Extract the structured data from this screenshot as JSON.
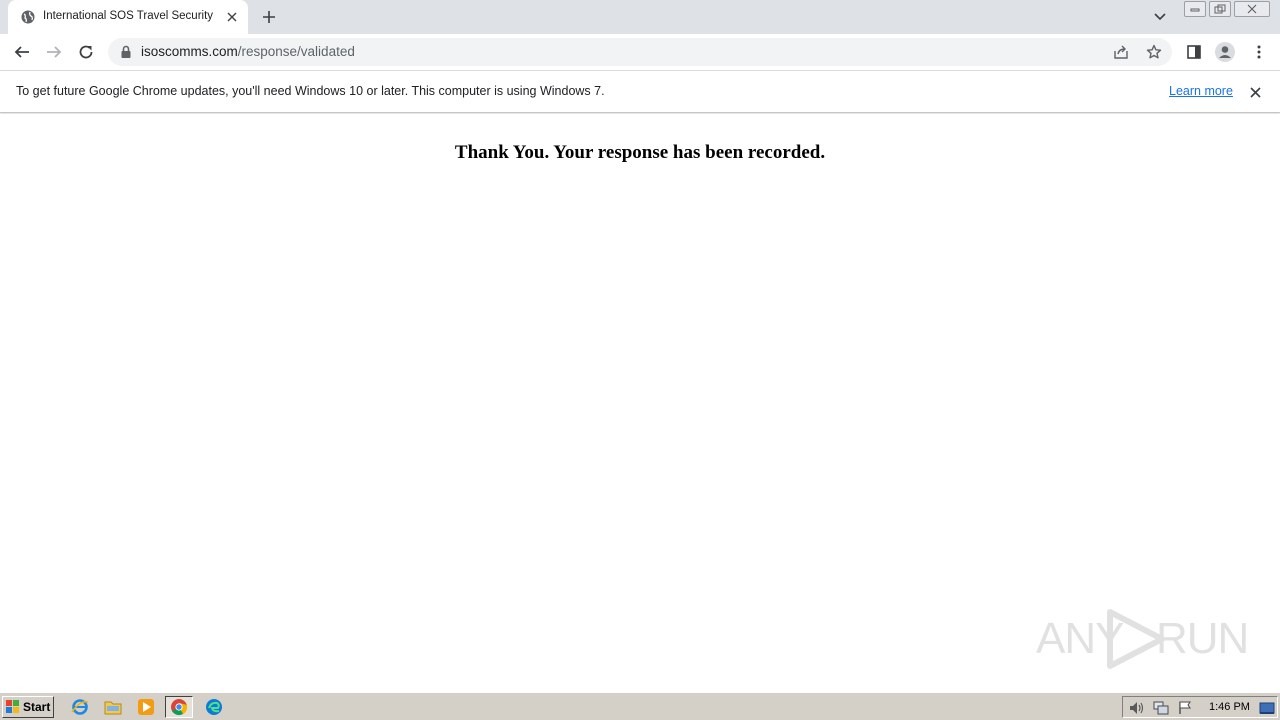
{
  "browser": {
    "tab": {
      "title": "International SOS Travel Security",
      "favicon": "globe-icon"
    },
    "address_bar": {
      "domain": "isoscomms.com",
      "path": "/response/validated"
    }
  },
  "infobar": {
    "message": "To get future Google Chrome updates, you'll need Windows 10 or later. This computer is using Windows 7.",
    "link_label": "Learn more"
  },
  "page": {
    "message": "Thank You. Your response has been recorded."
  },
  "watermark": {
    "left": "ANY",
    "right": "RUN"
  },
  "taskbar": {
    "start_label": "Start",
    "apps": [
      "internet-explorer-icon",
      "folder-icon",
      "media-player-icon",
      "chrome-icon",
      "edge-icon"
    ],
    "clock": "1:46 PM"
  },
  "colors": {
    "tabstrip": "#dee1e6",
    "omnibox": "#f1f3f4",
    "link": "#1a73e8",
    "taskbar": "#d4d0c8"
  }
}
